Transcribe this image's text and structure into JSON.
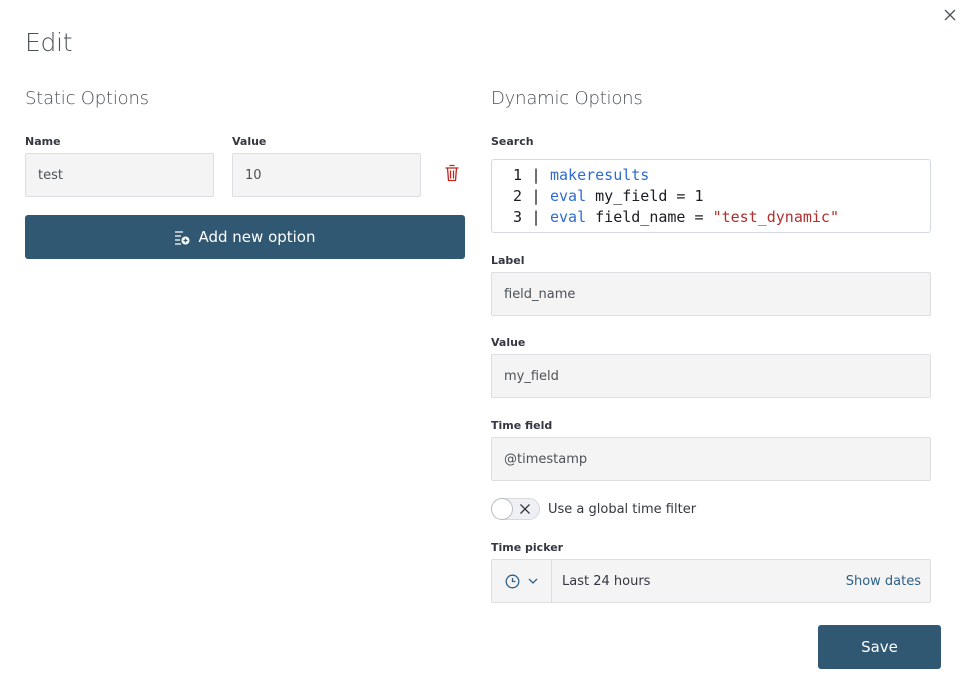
{
  "modal": {
    "title": "Edit",
    "close_icon": "close-icon"
  },
  "static_options": {
    "heading": "Static Options",
    "name_label": "Name",
    "name_value": "test",
    "value_label": "Value",
    "value_value": "10",
    "delete_icon": "trash-icon",
    "add_button_label": "Add new option",
    "add_button_icon": "list-add-icon"
  },
  "dynamic_options": {
    "heading": "Dynamic Options",
    "search_label": "Search",
    "search_lines": [
      {
        "num": "1",
        "sep": "|",
        "kw": "makeresults",
        "rest": "",
        "str": ""
      },
      {
        "num": "2",
        "sep": "|",
        "kw": "eval",
        "rest": " my_field = 1",
        "str": ""
      },
      {
        "num": "3",
        "sep": "|",
        "kw": "eval",
        "rest": " field_name = ",
        "str": "\"test_dynamic\""
      }
    ],
    "label_label": "Label",
    "label_value": "field_name",
    "value_label": "Value",
    "value_value": "my_field",
    "time_field_label": "Time field",
    "time_field_value": "@timestamp",
    "global_time_filter_label": "Use a global time filter",
    "global_time_filter_enabled": false,
    "time_picker_label": "Time picker",
    "time_picker_value": "Last 24 hours",
    "show_dates_label": "Show dates",
    "clock_icon": "clock-icon",
    "chevron_icon": "chevron-down-icon"
  },
  "footer": {
    "save_label": "Save"
  },
  "colors": {
    "primary": "#305872",
    "keyword": "#2f6bd3",
    "string": "#b32f2f",
    "danger": "#bd271e",
    "link": "#2f6088"
  }
}
